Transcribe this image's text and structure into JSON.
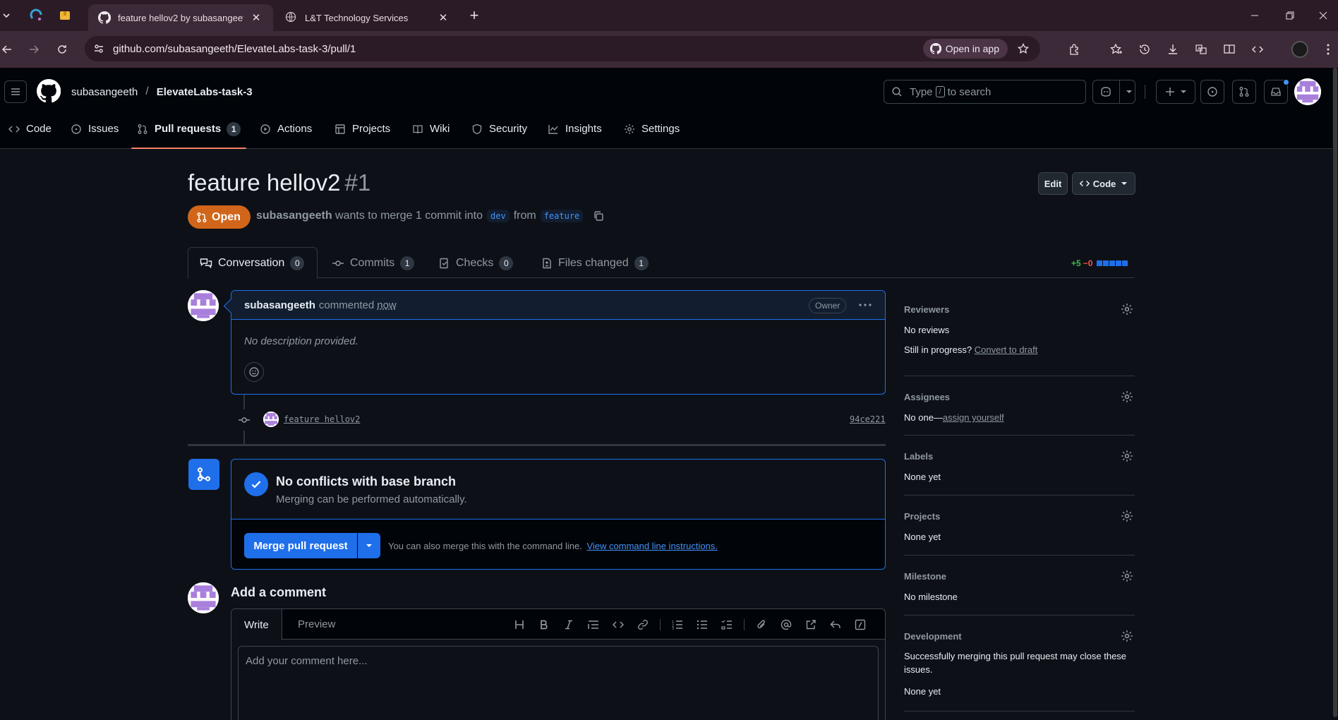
{
  "browser": {
    "tabs": [
      {
        "title": "feature hellov2 by subasangeeth",
        "active": true
      },
      {
        "title": "L&T Technology Services",
        "active": false
      }
    ],
    "url": "github.com/subasangeeth/ElevateLabs-task-3/pull/1",
    "open_in_app": "Open in app"
  },
  "header": {
    "owner": "subasangeeth",
    "separator": "/",
    "repo": "ElevateLabs-task-3",
    "search_pre": "Type",
    "search_key": "/",
    "search_post": "to search"
  },
  "repo_nav": [
    {
      "label": "Code",
      "icon": "code-icon"
    },
    {
      "label": "Issues",
      "icon": "issue-icon"
    },
    {
      "label": "Pull requests",
      "icon": "pull-request-icon",
      "count": "1",
      "active": true
    },
    {
      "label": "Actions",
      "icon": "play-icon"
    },
    {
      "label": "Projects",
      "icon": "table-icon"
    },
    {
      "label": "Wiki",
      "icon": "book-icon"
    },
    {
      "label": "Security",
      "icon": "shield-icon"
    },
    {
      "label": "Insights",
      "icon": "graph-icon"
    },
    {
      "label": "Settings",
      "icon": "gear-icon"
    }
  ],
  "pr": {
    "title": "feature hellov2",
    "number": "#1",
    "edit": "Edit",
    "code": "Code",
    "state": "Open",
    "author": "subasangeeth",
    "meta_mid": "wants to merge 1 commit into",
    "base": "dev",
    "meta_from": "from",
    "head": "feature"
  },
  "pr_tabs": [
    {
      "label": "Conversation",
      "count": "0",
      "active": true
    },
    {
      "label": "Commits",
      "count": "1"
    },
    {
      "label": "Checks",
      "count": "0"
    },
    {
      "label": "Files changed",
      "count": "1"
    }
  ],
  "diffstat": {
    "additions": "+5",
    "deletions": "−0"
  },
  "comment": {
    "author": "subasangeeth",
    "action": "commented",
    "time": "now",
    "badge": "Owner",
    "body": "No description provided."
  },
  "commit": {
    "message": "feature hellov2",
    "sha": "94ce221"
  },
  "merge": {
    "heading": "No conflicts with base branch",
    "sub": "Merging can be performed automatically.",
    "button": "Merge pull request",
    "note": "You can also merge this with the command line.",
    "note_link": "View command line instructions."
  },
  "add_comment": {
    "heading": "Add a comment",
    "tab_write": "Write",
    "tab_preview": "Preview",
    "placeholder": "Add your comment here..."
  },
  "sidebar": {
    "reviewers": {
      "title": "Reviewers",
      "value": "No reviews",
      "progress_q": "Still in progress?",
      "progress_link": "Convert to draft"
    },
    "assignees": {
      "title": "Assignees",
      "value": "No one—",
      "link": "assign yourself"
    },
    "labels": {
      "title": "Labels",
      "value": "None yet"
    },
    "projects": {
      "title": "Projects",
      "value": "None yet"
    },
    "milestone": {
      "title": "Milestone",
      "value": "No milestone"
    },
    "development": {
      "title": "Development",
      "desc": "Successfully merging this pull request may close these issues.",
      "value": "None yet"
    }
  },
  "colors": {
    "accent": "#1f6feb",
    "open_state": "#d1661a",
    "tab_underline": "#f78166",
    "link": "#4493f8"
  }
}
